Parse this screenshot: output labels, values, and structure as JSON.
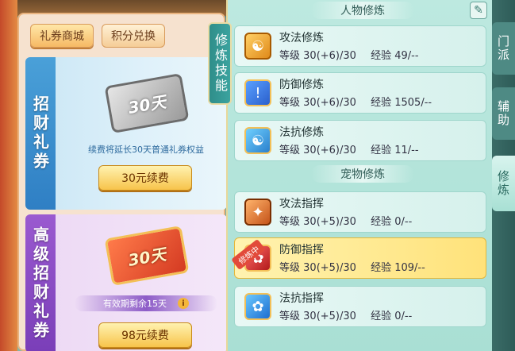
{
  "shop": {
    "tabs": [
      {
        "label": "礼券商城",
        "active": true
      },
      {
        "label": "积分兑换",
        "active": false
      }
    ],
    "cards": [
      {
        "side_label": "招财礼券",
        "ticket_text": "30天",
        "note": "续费将延长30天普通礼券权益",
        "button": "30元续费"
      },
      {
        "side_label": "高级招财礼券",
        "ticket_text": "30天",
        "note": "有效期剩余15天",
        "button": "98元续费"
      }
    ]
  },
  "cultivation": {
    "vertical_title": "修炼技能",
    "edit_icon": "edit-icon",
    "sections": [
      {
        "header": "人物修炼",
        "skills": [
          {
            "name": "攻法修炼",
            "level_label": "等级",
            "level": "30(+6)/30",
            "exp_label": "经验",
            "exp": "49/--",
            "icon": "meditating-monk-icon"
          },
          {
            "name": "防御修炼",
            "level_label": "等级",
            "level": "30(+6)/30",
            "exp_label": "经验",
            "exp": "1505/--",
            "icon": "shield-icon"
          },
          {
            "name": "法抗修炼",
            "level_label": "等级",
            "level": "30(+6)/30",
            "exp_label": "经验",
            "exp": "11/--",
            "icon": "taiji-shield-icon"
          }
        ]
      },
      {
        "header": "宠物修炼",
        "skills": [
          {
            "name": "攻法指挥",
            "level_label": "等级",
            "level": "30(+5)/30",
            "exp_label": "经验",
            "exp": "0/--",
            "icon": "claw-icon"
          },
          {
            "name": "防御指挥",
            "level_label": "等级",
            "level": "30(+5)/30",
            "exp_label": "经验",
            "exp": "109/--",
            "icon": "paw-shield-icon",
            "badge": "修炼中",
            "highlighted": true
          },
          {
            "name": "法抗指挥",
            "level_label": "等级",
            "level": "30(+5)/30",
            "exp_label": "经验",
            "exp": "0/--",
            "icon": "paw-magic-icon"
          }
        ]
      }
    ]
  },
  "side_tabs": [
    {
      "label": "门派",
      "active": false
    },
    {
      "label": "辅助",
      "active": false
    },
    {
      "label": "修炼",
      "active": true
    }
  ],
  "colors": {
    "highlight": "#ffe27a",
    "panel": "#bde9e0",
    "button": "#f7c44b"
  }
}
